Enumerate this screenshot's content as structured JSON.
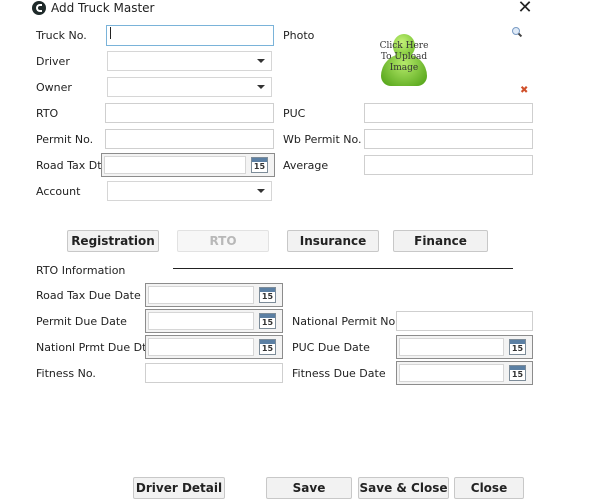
{
  "window": {
    "title": "Add Truck Master",
    "close_icon": "close-icon",
    "app_icon": "app-logo-icon"
  },
  "form": {
    "truck_no": {
      "label": "Truck No.",
      "value": ""
    },
    "driver": {
      "label": "Driver",
      "value": ""
    },
    "owner": {
      "label": "Owner",
      "value": ""
    },
    "rto": {
      "label": "RTO",
      "value": ""
    },
    "permit_no": {
      "label": "Permit No.",
      "value": ""
    },
    "road_tax_dt": {
      "label": "Road Tax Dt.",
      "value": ""
    },
    "account": {
      "label": "Account",
      "value": ""
    },
    "photo": {
      "label": "Photo",
      "placeholder": "Click Here To Upload Image",
      "zoom_icon": "magnifier-icon",
      "remove_icon": "remove-icon"
    },
    "puc": {
      "label": "PUC",
      "value": ""
    },
    "wb_permit_no": {
      "label": "Wb Permit No.",
      "value": ""
    },
    "average": {
      "label": "Average",
      "value": ""
    },
    "calendar_day": "15"
  },
  "tabs": [
    {
      "label": "Registration",
      "enabled": true
    },
    {
      "label": "RTO",
      "enabled": false
    },
    {
      "label": "Insurance",
      "enabled": true
    },
    {
      "label": "Finance",
      "enabled": true
    }
  ],
  "rto_section": {
    "title": "RTO Information",
    "road_tax_due_date": {
      "label": "Road Tax Due Date",
      "value": ""
    },
    "permit_due_date": {
      "label": "Permit Due Date",
      "value": ""
    },
    "national_permit_due_dt": {
      "label": "Nationl Prmt Due Dt",
      "value": ""
    },
    "fitness_no": {
      "label": "Fitness No.",
      "value": ""
    },
    "national_permit_no": {
      "label": "National Permit No",
      "value": ""
    },
    "puc_due_date": {
      "label": "PUC Due Date",
      "value": ""
    },
    "fitness_due_date": {
      "label": "Fitness Due Date",
      "value": ""
    }
  },
  "footer": {
    "driver_detail": "Driver Detail",
    "save": "Save",
    "save_close": "Save & Close",
    "close": "Close"
  }
}
